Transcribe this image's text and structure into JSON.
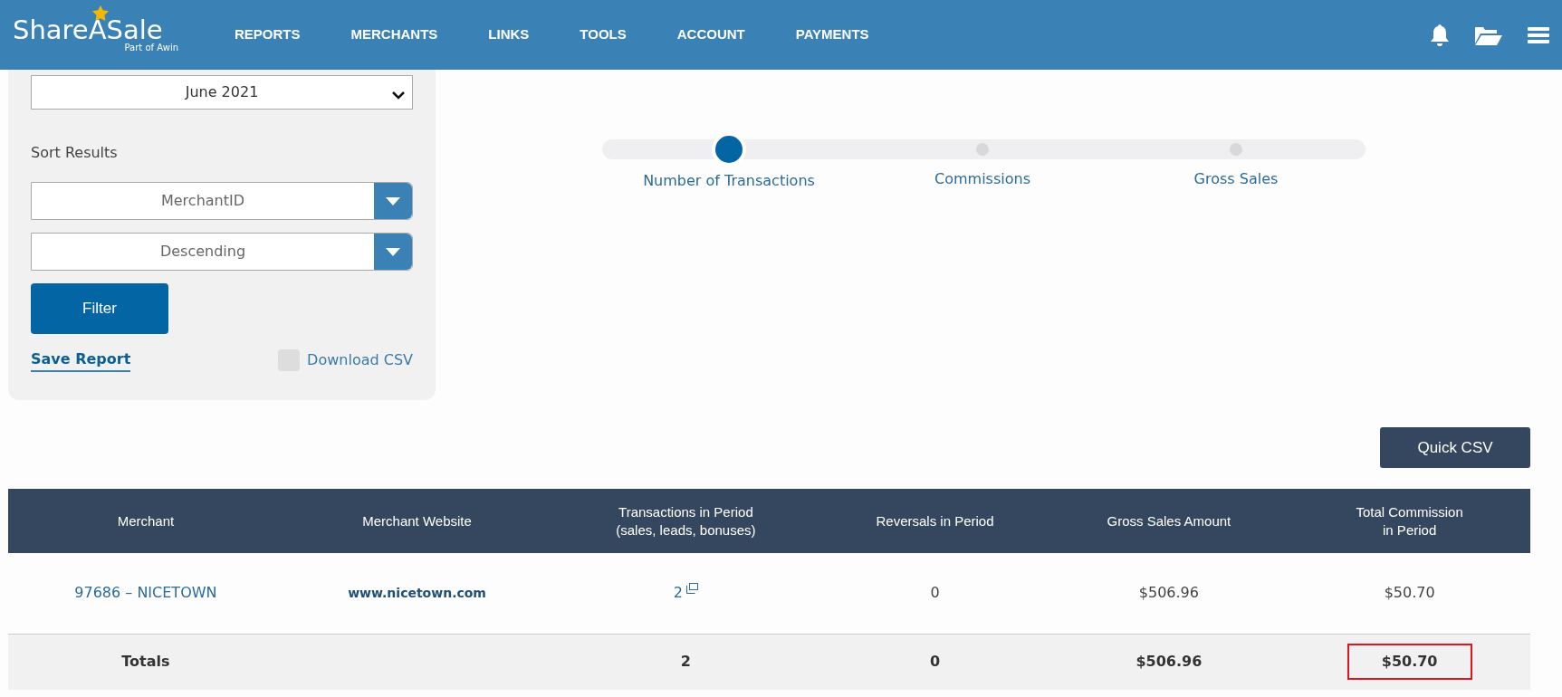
{
  "header": {
    "logo": "ShareASale",
    "logo_sub": "Part of Awin",
    "nav": [
      "REPORTS",
      "MERCHANTS",
      "LINKS",
      "TOOLS",
      "ACCOUNT",
      "PAYMENTS"
    ]
  },
  "filters": {
    "month": "June 2021",
    "sort_label": "Sort Results",
    "sort_by": "MerchantID",
    "sort_order": "Descending",
    "filter_button": "Filter",
    "save_link": "Save Report",
    "download": {
      "label": "Download CSV",
      "checked": false
    }
  },
  "stepper": [
    {
      "label": "Number of Transactions",
      "selected": true
    },
    {
      "label": "Commissions",
      "selected": false
    },
    {
      "label": "Gross Sales",
      "selected": false
    }
  ],
  "quick_csv": "Quick CSV",
  "table": {
    "columns": [
      "Merchant",
      "Merchant Website",
      "Transactions in Period\n(sales, leads, bonuses)",
      "Reversals in Period",
      "Gross Sales Amount",
      "Total Commission\nin Period"
    ],
    "rows": [
      {
        "merchant": "97686 – NICETOWN",
        "website": "www.nicetown.com",
        "transactions": "2",
        "reversals": "0",
        "gross": "$506.96",
        "commission": "$50.70"
      }
    ],
    "totals": {
      "label": "Totals",
      "transactions": "2",
      "reversals": "0",
      "gross": "$506.96",
      "commission": "$50.70",
      "commission_highlighted": true
    }
  }
}
